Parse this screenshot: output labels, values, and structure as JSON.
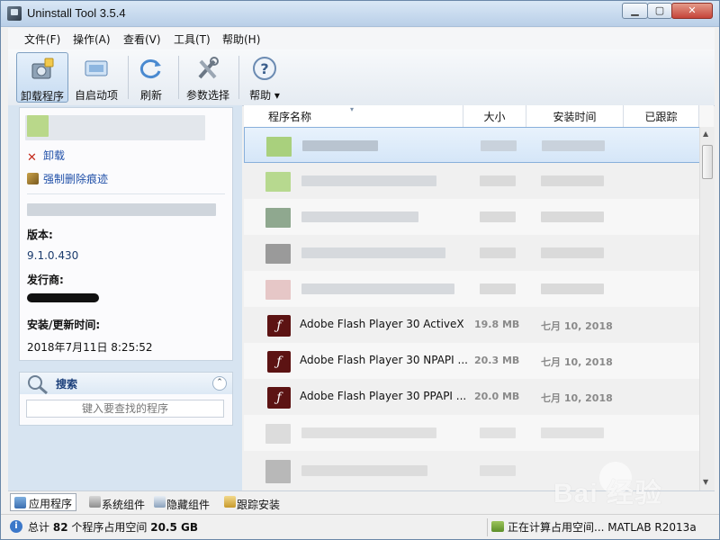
{
  "window": {
    "title": "Uninstall Tool 3.5.4"
  },
  "menu": [
    "文件(F)",
    "操作(A)",
    "查看(V)",
    "工具(T)",
    "帮助(H)"
  ],
  "toolbar": [
    {
      "label": "卸载程序",
      "icon": "uninstall-icon",
      "active": true
    },
    {
      "label": "自启动项",
      "icon": "autorun-icon",
      "active": false
    },
    {
      "label": "刷新",
      "icon": "refresh-icon",
      "active": false
    },
    {
      "label": "参数选择",
      "icon": "settings-icon",
      "active": false
    },
    {
      "label": "帮助",
      "icon": "help-icon",
      "active": false
    }
  ],
  "details": {
    "uninstall_link": "卸载",
    "force_remove_link": "强制删除痕迹",
    "version_label": "版本:",
    "version_value": "9.1.0.430",
    "publisher_label": "发行商:",
    "install_time_label": "安装/更新时间:",
    "install_time_value": "2018年7月11日 8:25:52"
  },
  "search": {
    "title": "搜索",
    "placeholder": "键入要查找的程序"
  },
  "columns": {
    "name": "程序名称",
    "size": "大小",
    "install_time": "安装时间",
    "tracked": "已跟踪"
  },
  "programs": [
    {
      "name": "Adobe Flash Player 30 ActiveX",
      "size": "19.8 MB",
      "date": "七月 10, 2018"
    },
    {
      "name": "Adobe Flash Player 30 NPAPI ...",
      "size": "20.3 MB",
      "date": "七月 10, 2018"
    },
    {
      "name": "Adobe Flash Player 30 PPAPI ...",
      "size": "20.0 MB",
      "date": "七月 10, 2018"
    }
  ],
  "tabs": [
    "应用程序",
    "系统组件",
    "隐藏组件",
    "跟踪安装"
  ],
  "status": {
    "prefix": "总计",
    "count": "82",
    "middle": "个程序占用空间",
    "space": "20.5 GB",
    "progress_text": "正在计算占用空间... MATLAB R2013a"
  },
  "watermark": "Bai 经验",
  "colors": {
    "selection": "#d5e6f8",
    "flash": "#5c1313",
    "link": "#1f4fa8"
  }
}
